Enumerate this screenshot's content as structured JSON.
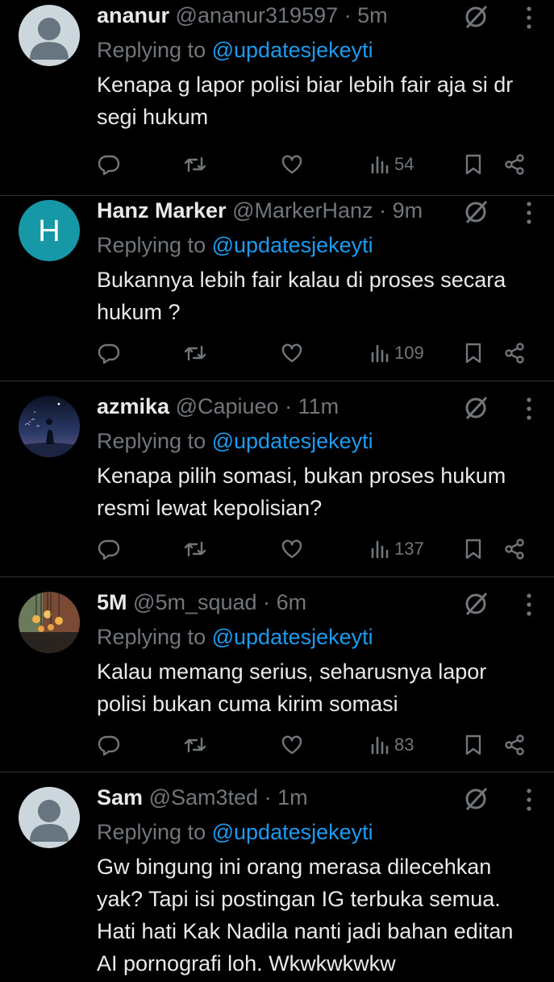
{
  "reply_prefix": "Replying to",
  "tweets": [
    {
      "name": "ananur",
      "handle": "@ananur319597",
      "sep": "·",
      "time": "5m",
      "reply_to": "@updatesjekeyti",
      "text": "Kenapa g lapor polisi biar lebih fair aja si dr segi hukum",
      "views": "54",
      "avatar": "default-avatar"
    },
    {
      "name": "Hanz Marker",
      "handle": "@MarkerHanz",
      "sep": "·",
      "time": "9m",
      "reply_to": "@updatesjekeyti",
      "text": "Bukannya lebih fair kalau di proses secara hukum ?",
      "views": "109",
      "avatar": "letter-avatar",
      "avatar_letter": "H",
      "avatar_color": "#1798a6"
    },
    {
      "name": "azmika",
      "handle": "@Capiueo",
      "sep": "·",
      "time": "11m",
      "reply_to": "@updatesjekeyti",
      "text": "Kenapa pilih somasi, bukan proses hukum resmi lewat kepolisian?",
      "views": "137",
      "avatar": "night-sky-avatar"
    },
    {
      "name": "5M",
      "handle": "@5m_squad",
      "sep": "·",
      "time": "6m",
      "reply_to": "@updatesjekeyti",
      "text": "Kalau memang serius, seharusnya lapor polisi bukan cuma kirim somasi",
      "views": "83",
      "avatar": "lamps-avatar"
    },
    {
      "name": "Sam",
      "handle": "@Sam3ted",
      "sep": "·",
      "time": "1m",
      "reply_to": "@updatesjekeyti",
      "text": "Gw bingung ini orang merasa dilecehkan yak? Tapi isi postingan IG terbuka semua. Hati hati Kak Nadila nanti jadi bahan editan AI pornografi loh. Wkwkwkwkw",
      "avatar": "default-avatar"
    }
  ],
  "icons": {
    "reply": "reply-icon",
    "retweet": "retweet-icon",
    "like": "like-icon",
    "views": "views-icon",
    "bookmark": "bookmark-icon",
    "share": "share-icon",
    "grok": "grok-icon",
    "more": "more-icon"
  },
  "colors": {
    "background": "#000000",
    "text": "#e7e9ea",
    "muted": "#71767b",
    "link": "#1d9bf0",
    "divider": "#2f3336"
  }
}
